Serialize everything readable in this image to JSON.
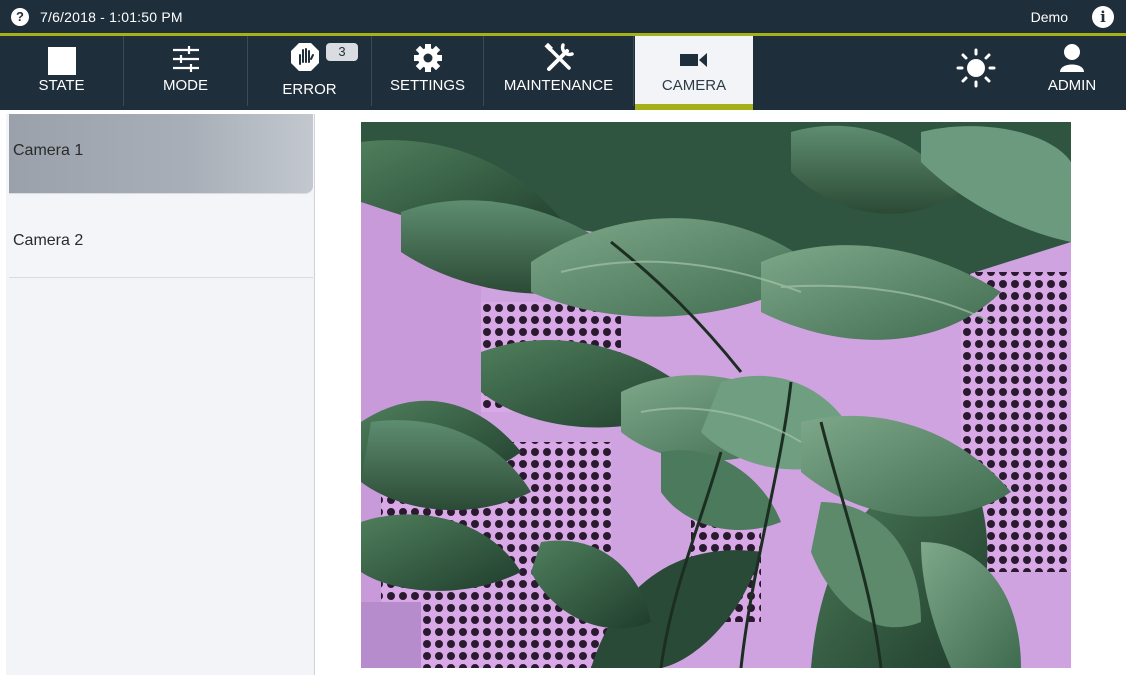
{
  "statusbar": {
    "datetime": "7/6/2018 - 1:01:50 PM",
    "user": "Demo"
  },
  "nav": {
    "items": [
      {
        "label": "STATE",
        "icon": "square-icon"
      },
      {
        "label": "MODE",
        "icon": "sliders-icon"
      },
      {
        "label": "ERROR",
        "icon": "stop-hand-icon",
        "badge": "3"
      },
      {
        "label": "SETTINGS",
        "icon": "gear-icon"
      },
      {
        "label": "MAINTENANCE",
        "icon": "tools-icon"
      },
      {
        "label": "CAMERA",
        "icon": "video-camera-icon",
        "active": true
      }
    ],
    "right_items": [
      {
        "label": "",
        "icon": "brightness-icon"
      },
      {
        "label": "ADMIN",
        "icon": "user-icon"
      }
    ]
  },
  "cameras": {
    "items": [
      {
        "label": "Camera 1",
        "selected": true
      },
      {
        "label": "Camera 2",
        "selected": false
      }
    ]
  },
  "colors": {
    "header_bg": "#1f2e3b",
    "accent": "#a6b11a",
    "sidebar_bg": "#f2f4f7"
  }
}
